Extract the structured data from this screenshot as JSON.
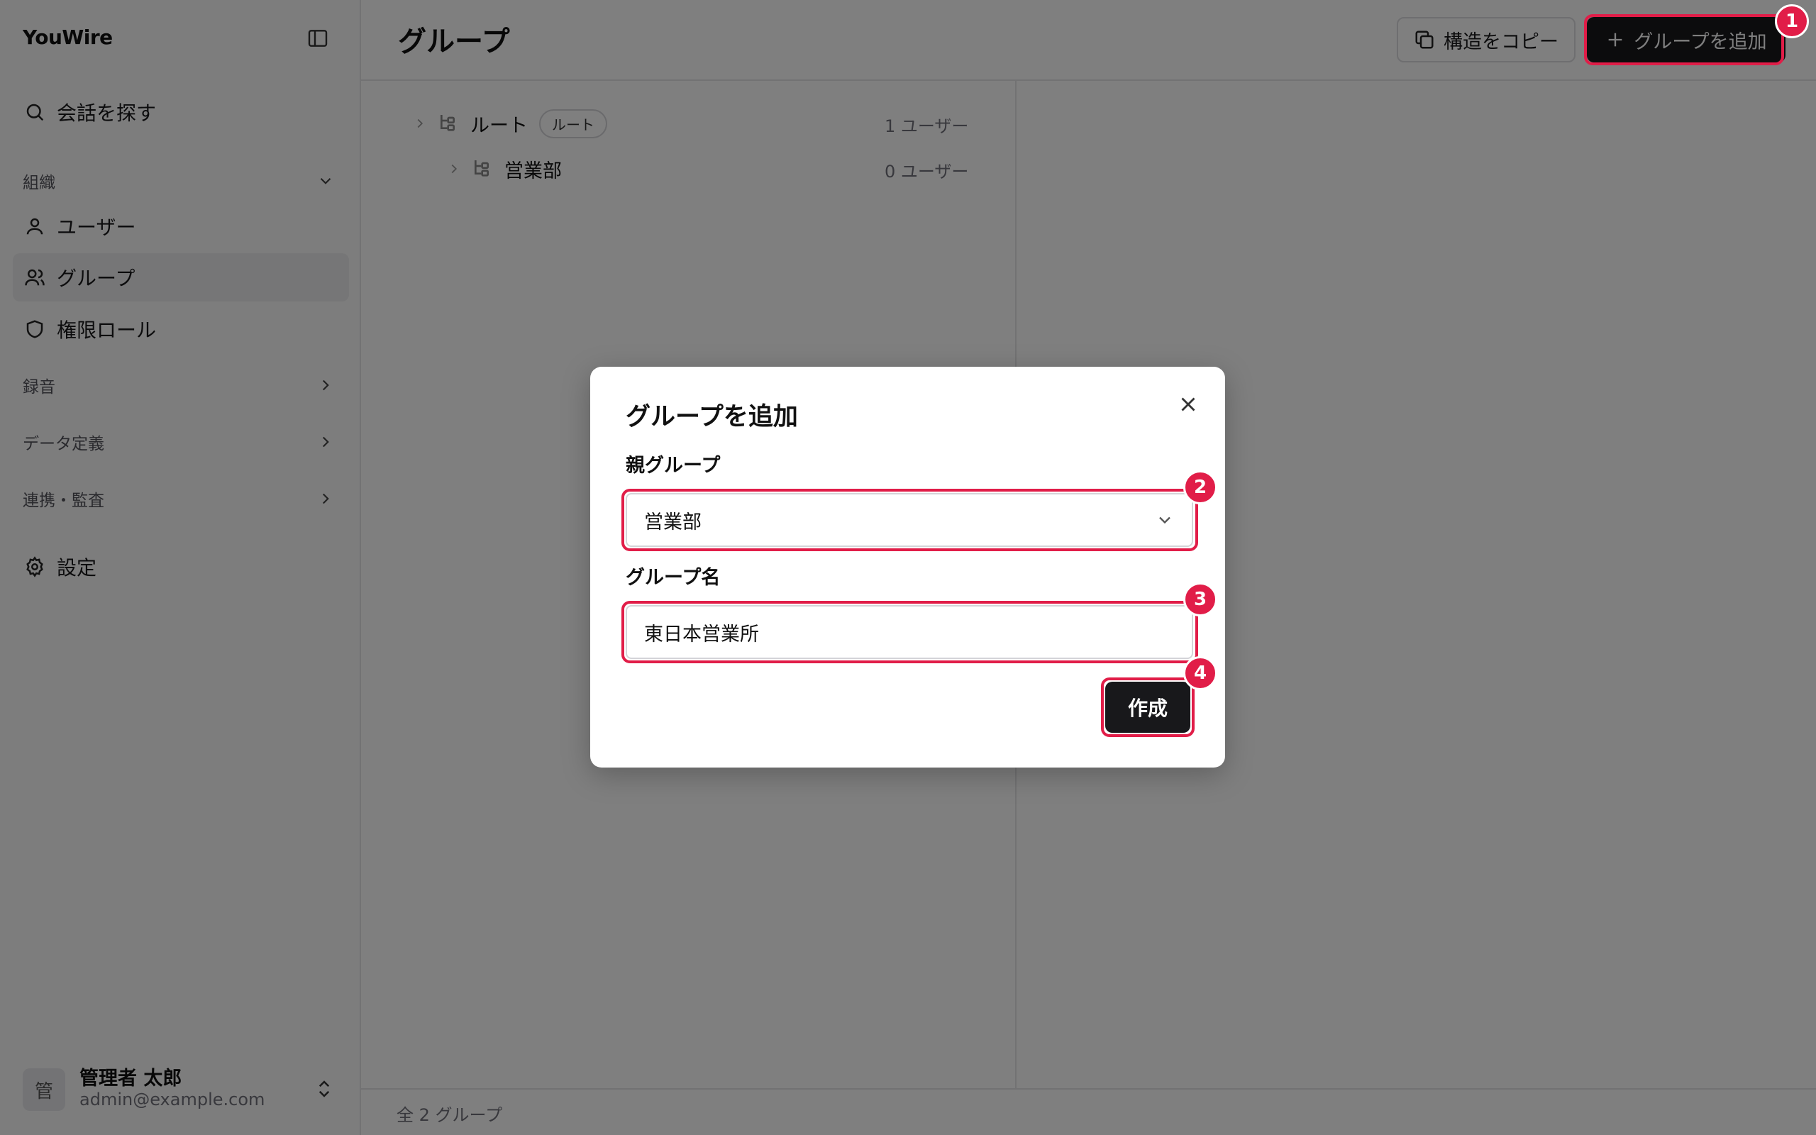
{
  "app": {
    "brand": "YouWire"
  },
  "sidebar": {
    "search_label": "会話を探す",
    "sections": {
      "org": "組織",
      "recording": "録音",
      "data_def": "データ定義",
      "integration": "連携・監査"
    },
    "items": {
      "users": "ユーザー",
      "groups": "グループ",
      "roles": "権限ロール",
      "settings": "設定"
    },
    "user": {
      "avatar_char": "管",
      "name": "管理者 太郎",
      "email": "admin@example.com"
    }
  },
  "header": {
    "title": "グループ",
    "copy_button": "構造をコピー",
    "add_button": "グループを追加"
  },
  "tree": {
    "rows": [
      {
        "name": "ルート",
        "badge": "ルート",
        "count": "1 ユーザー"
      },
      {
        "name": "営業部",
        "count": "0 ユーザー"
      }
    ]
  },
  "footer": {
    "total": "全 2 グループ"
  },
  "dialog": {
    "title": "グループを追加",
    "parent_label": "親グループ",
    "parent_value": "営業部",
    "name_label": "グループ名",
    "name_value": "東日本営業所",
    "create_button": "作成"
  },
  "steps": [
    "1",
    "2",
    "3",
    "4"
  ],
  "colors": {
    "accent": "#e11d48",
    "primary": "#18181b",
    "overlay": "rgba(0,0,0,0.5)"
  }
}
